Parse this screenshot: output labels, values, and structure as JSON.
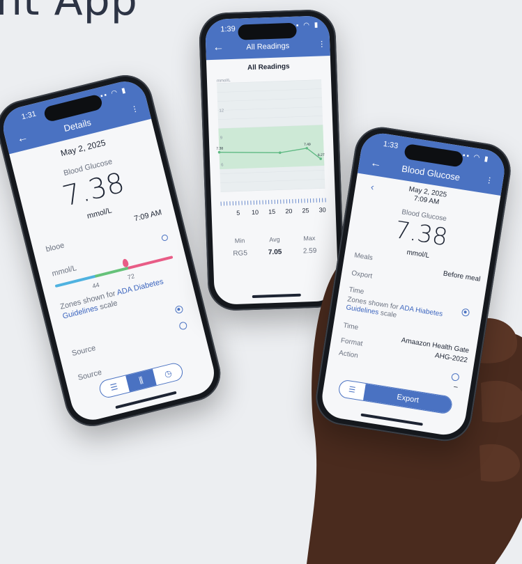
{
  "heading": "nt App",
  "left_phone": {
    "status_time": "1:31",
    "title": "Details",
    "date": "May 2, 2025",
    "metric_label": "Blood Glucose",
    "value": "7.38",
    "unit": "mmol/L",
    "time": "7:09 AM",
    "row_label": "blooе",
    "scale_label": "mmol/L",
    "tick_left": "44",
    "tick_right": "72",
    "zones_prefix": "Zones shown for ",
    "zones_link": "ADA Diabetes Guidelines",
    "zones_suffix": " scale",
    "source_1": "Source",
    "source_2": "Source"
  },
  "middle_phone": {
    "status_time": "1:39",
    "title": "All Readings",
    "chart_title": "All Readings",
    "stats_headers": [
      "Min",
      "Avg",
      "Max"
    ],
    "stats_values": [
      "RG5",
      "7.05",
      "2.59"
    ]
  },
  "chart_data": {
    "type": "line",
    "title": "All Readings",
    "ylabel": "mmol/L",
    "yticks": [
      12,
      9,
      6
    ],
    "xticks": [
      5,
      10,
      15,
      20,
      25,
      30
    ],
    "target_band": [
      5.5,
      10
    ],
    "series": [
      {
        "x": [
          0,
          18,
          26,
          30
        ],
        "y": [
          7.38,
          7.1,
          7.49,
          6.27
        ]
      }
    ],
    "point_labels": [
      "7.38",
      "7.49",
      "6.27"
    ],
    "colors": {
      "line": "#5fb983",
      "band": "#cde9d6"
    }
  },
  "right_phone": {
    "status_time": "1:33",
    "title": "Blood Glucose",
    "date": "May 2, 2025",
    "time": "7:09 AM",
    "metric_label": "Blood Glucose",
    "value": "7.38",
    "unit": "mmol/L",
    "meals_label": "Meals",
    "meals_value": "Before meal",
    "export_label": "Oxport",
    "time_label": "Time",
    "zones_prefix": "Zones shown for ",
    "zones_link": "ADA Hiabetes Guidelines",
    "zones_suffix": " scale",
    "time_label_2": "Time",
    "source_value": "Amaazon Health Gate",
    "format_label": "Format",
    "format_value": "AHG-2022",
    "action_label": "Action",
    "action_value": "–",
    "export_button": "Export"
  },
  "colors": {
    "accent": "#4a72c2",
    "zone_blue": "#4fb2e0",
    "zone_green": "#66c27a",
    "zone_pink": "#e85c86"
  }
}
